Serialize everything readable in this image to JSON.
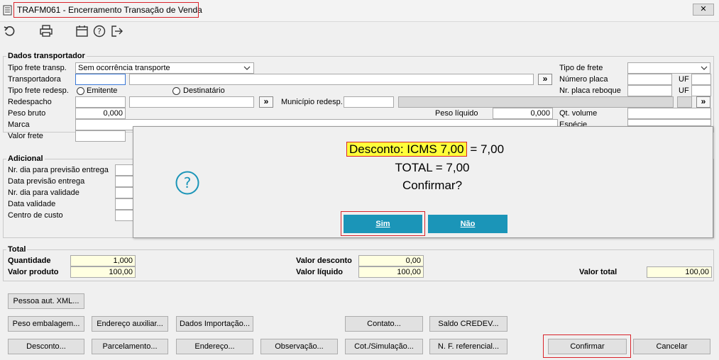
{
  "window": {
    "title": "TRAFM061 - Encerramento Transação de Venda",
    "close_label": "✕"
  },
  "toolbar": {
    "icons": [
      "undo-icon",
      "print-icon",
      "calendar-icon",
      "help-icon",
      "exit-icon"
    ]
  },
  "transportador": {
    "legend": "Dados transportador",
    "tipo_frete_transp_label": "Tipo frete transp.",
    "tipo_frete_transp_value": "Sem ocorrência transporte",
    "transportadora_label": "Transportadora",
    "tipo_frete_redesp_label": "Tipo frete redesp.",
    "radio_emitente": "Emitente",
    "radio_destinatario": "Destinatário",
    "redespacho_label": "Redespacho",
    "municipio_redesp_label": "Município redesp.",
    "peso_bruto_label": "Peso bruto",
    "peso_bruto_value": "0,000",
    "peso_liquido_label": "Peso líquido",
    "peso_liquido_value": "0,000",
    "marca_label": "Marca",
    "valor_frete_label": "Valor frete",
    "tipo_de_frete_label": "Tipo de frete",
    "numero_placa_label": "Número placa",
    "nr_placa_reboque_label": "Nr. placa reboque",
    "uf_label": "UF",
    "qt_volume_label": "Qt. volume",
    "especie_label": "Espécie",
    "more_button": "»"
  },
  "adicional": {
    "legend": "Adicional",
    "fields": [
      "Nr. dia para previsão entrega",
      "Data previsão entrega",
      "Nr. dia para validade",
      "Data validade",
      "Centro de custo"
    ]
  },
  "total": {
    "legend": "Total",
    "quantidade_label": "Quantidade",
    "quantidade_value": "1,000",
    "valor_produto_label": "Valor produto",
    "valor_produto_value": "100,00",
    "valor_desconto_label": "Valor desconto",
    "valor_desconto_value": "0,00",
    "valor_liquido_label": "Valor líquido",
    "valor_liquido_value": "100,00",
    "valor_total_label": "Valor total",
    "valor_total_value": "100,00"
  },
  "buttons": {
    "pessoa_aut_xml": "Pessoa aut. XML...",
    "peso_embalagem": "Peso embalagem...",
    "endereco_auxiliar": "Endereço auxiliar...",
    "dados_importacao": "Dados Importação...",
    "contato": "Contato...",
    "saldo_credev": "Saldo CREDEV...",
    "desconto": "Desconto...",
    "parcelamento": "Parcelamento...",
    "endereco": "Endereço...",
    "observacao": "Observação...",
    "cot_simulacao": "Cot./Simulação...",
    "nf_referencial": "N. F. referencial...",
    "confirmar": "Confirmar",
    "cancelar": "Cancelar"
  },
  "dialog": {
    "desconto_highlight": "Desconto: ICMS 7,00",
    "desconto_rest": "= 7,00",
    "total_line": "TOTAL = 7,00",
    "question": "Confirmar?",
    "sim": "Sim",
    "nao": "Não"
  },
  "colors": {
    "highlight_box": "#d9242b",
    "dialog_button": "#1b95b8",
    "text_highlight": "#ffff3a",
    "yellow_field": "#ffffe1"
  }
}
